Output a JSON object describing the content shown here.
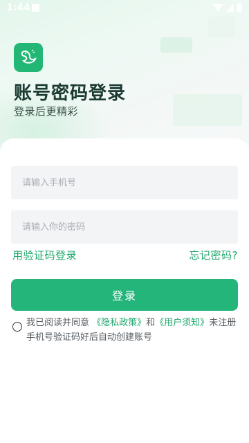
{
  "status_bar": {
    "time": "1:44"
  },
  "header": {
    "logo_icon": "swan-logo-icon",
    "title": "账号密码登录",
    "subtitle": "登录后更精彩"
  },
  "form": {
    "phone_placeholder": "请输入手机号",
    "password_placeholder": "请输入你的密码",
    "sms_login_link": "用验证码登录",
    "forgot_password_link": "忘记密码?",
    "login_button": "登录"
  },
  "agreement": {
    "prefix": "我已阅读并同意 ",
    "privacy_link": "《隐私政策》",
    "and": "和",
    "user_link": "《用户须知》",
    "suffix": "未注册手机号验证码好后自动创建账号"
  },
  "colors": {
    "accent": "#24b57b",
    "link": "#1aa66a",
    "title": "#1a3a32"
  }
}
